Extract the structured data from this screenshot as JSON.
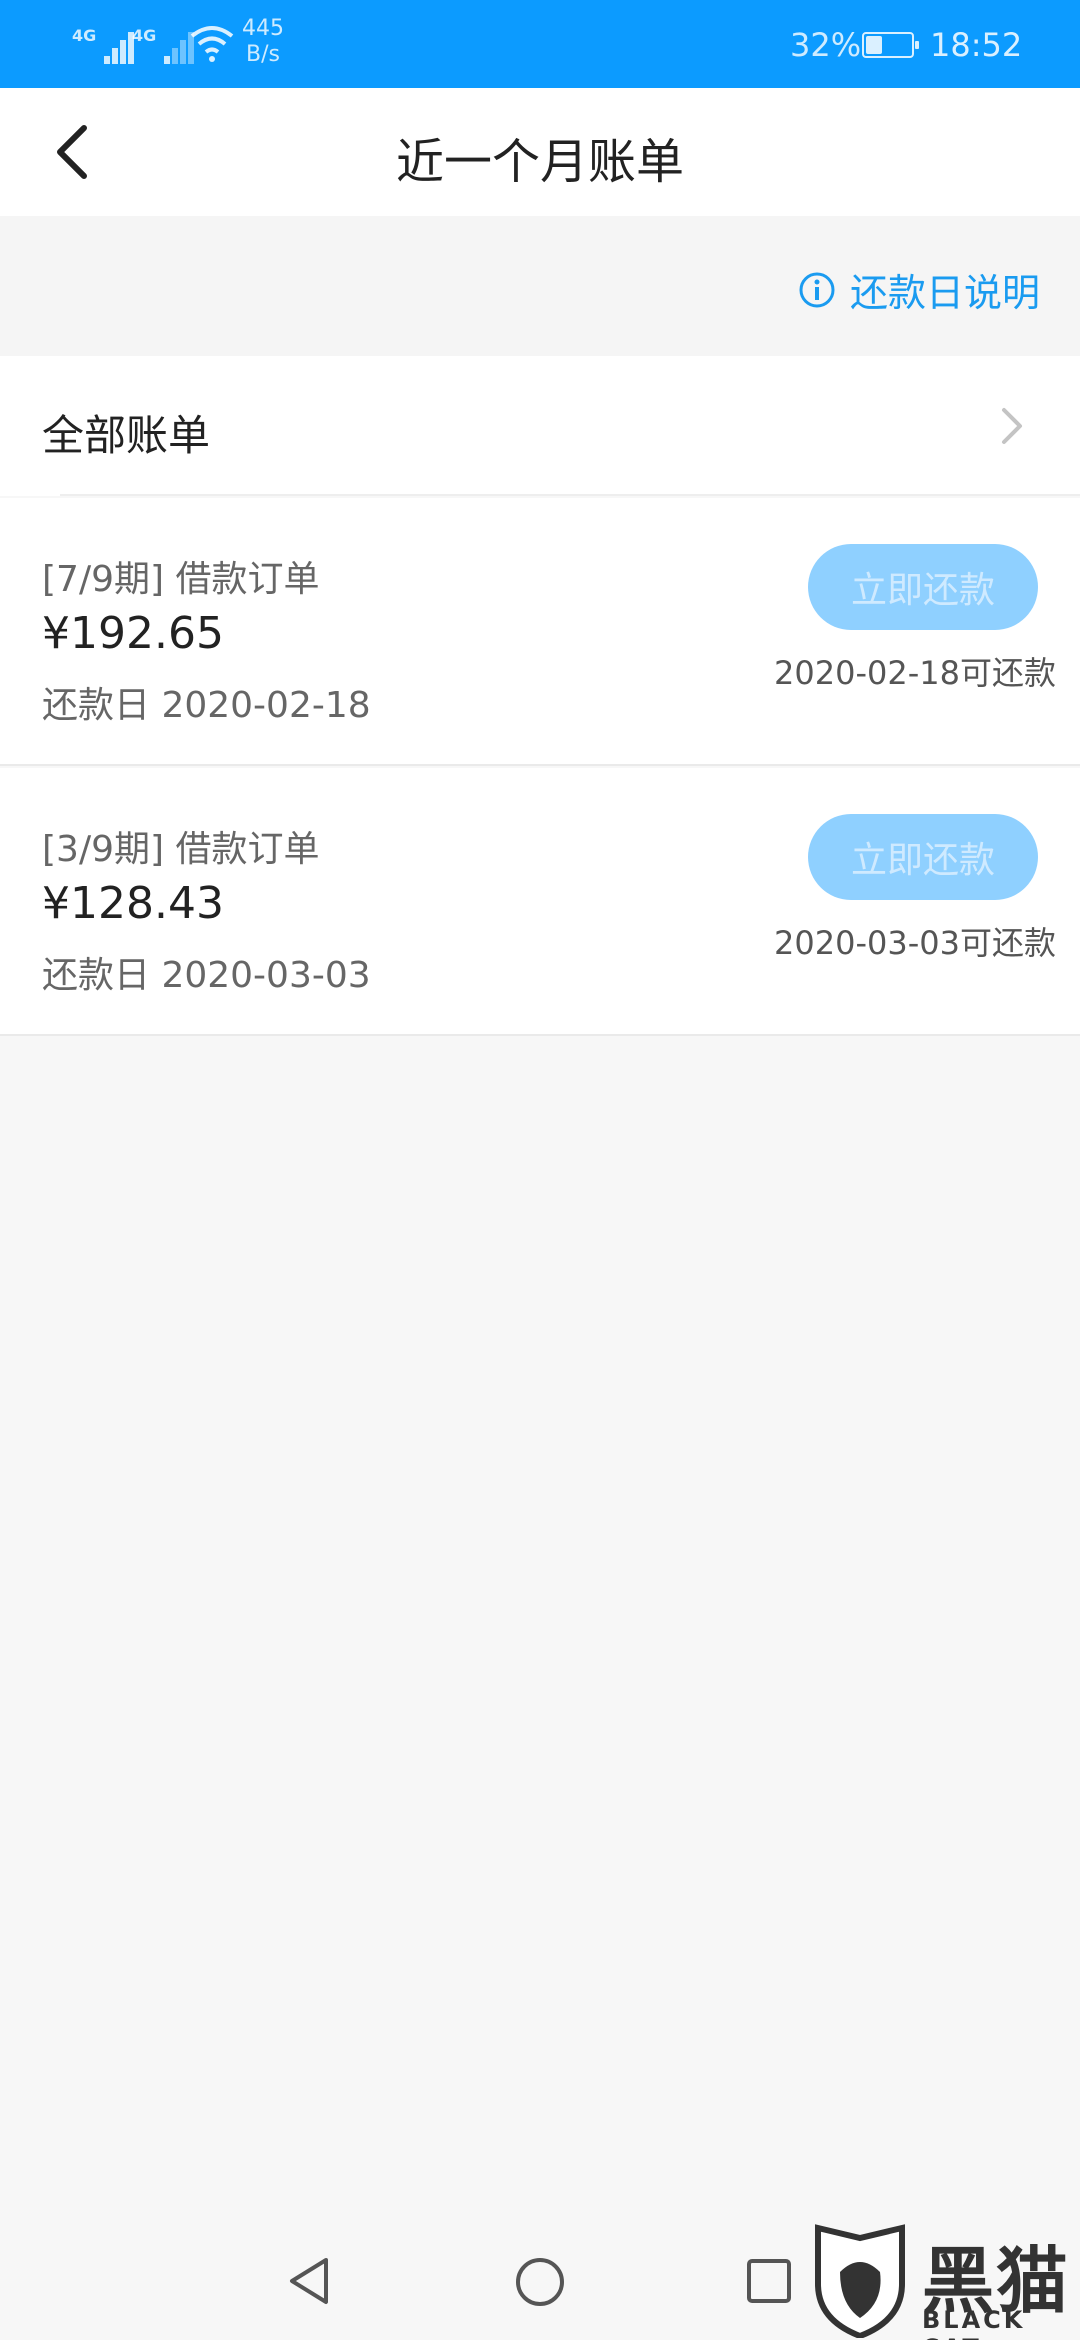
{
  "status_bar": {
    "network_1": "4G",
    "network_2": "4G",
    "speed_value": "445",
    "speed_unit": "B/s",
    "battery": "32%",
    "time": "18:52"
  },
  "header": {
    "title": "近一个月账单"
  },
  "info": {
    "label": "还款日说明"
  },
  "all_bills": {
    "label": "全部账单"
  },
  "bills": [
    {
      "term": "[7/9期] 借款订单",
      "amount": "¥192.65",
      "due": "还款日 2020-02-18",
      "button": "立即还款",
      "available": "2020-02-18可还款"
    },
    {
      "term": "[3/9期] 借款订单",
      "amount": "¥128.43",
      "due": "还款日 2020-03-03",
      "button": "立即还款",
      "available": "2020-03-03可还款"
    }
  ],
  "watermark": {
    "cn": "黑猫",
    "en": "BLACK CAT"
  },
  "colors": {
    "status_bar": "#0c9bff",
    "accent": "#1a9bf0",
    "button_disabled": "#8fd0ff"
  }
}
